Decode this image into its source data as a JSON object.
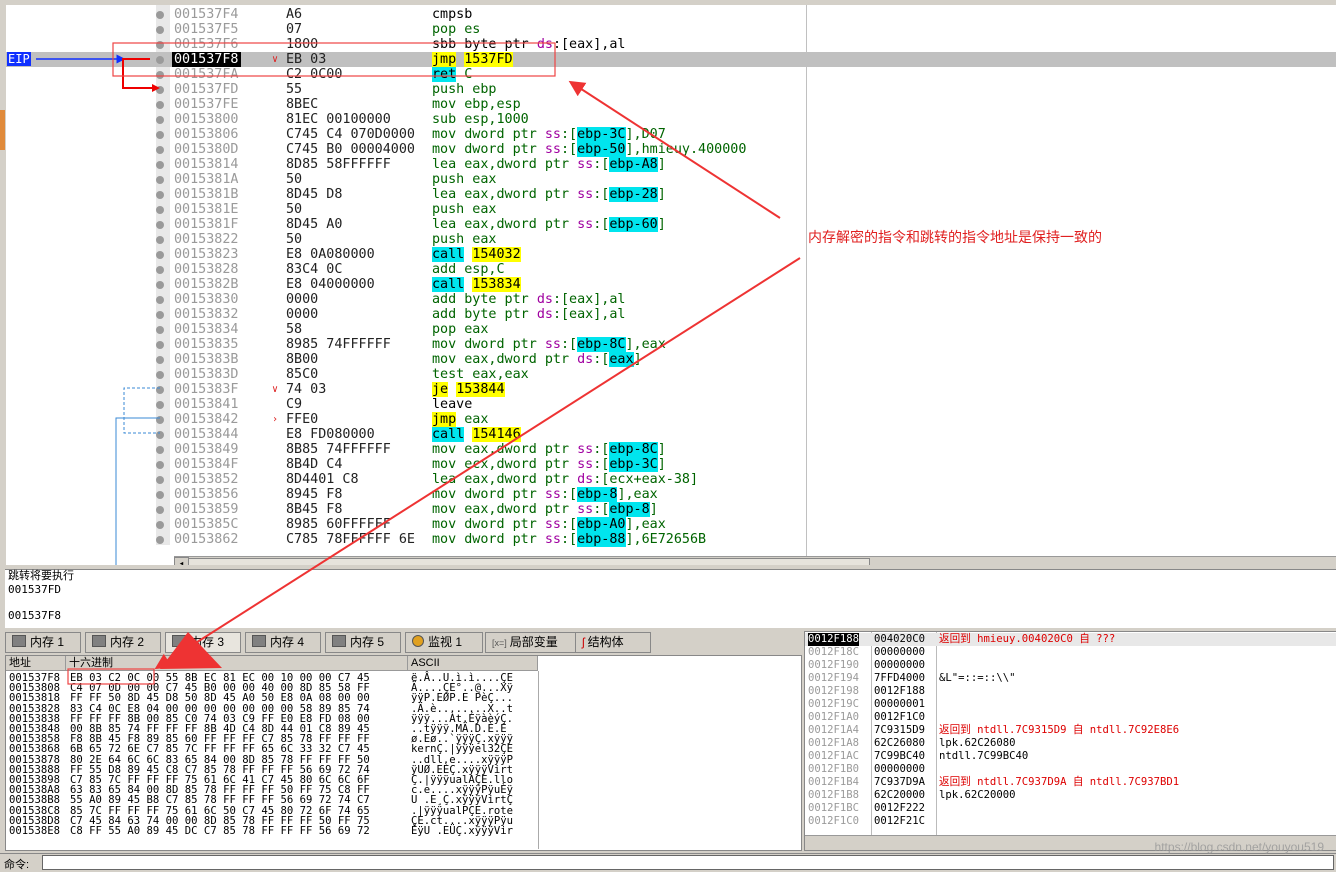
{
  "eip_label": "EIP",
  "disasm": [
    {
      "addr": "001537F4",
      "hex": "A6",
      "asm": [
        [
          "cmpsb",
          "k"
        ]
      ]
    },
    {
      "addr": "001537F5",
      "hex": "07",
      "asm": [
        [
          "pop es",
          "g"
        ]
      ]
    },
    {
      "addr": "001537F6",
      "hex": "1800",
      "asm": [
        [
          "sbb byte ptr ",
          "k"
        ],
        [
          "ds",
          "s"
        ],
        [
          ":[eax],al",
          "k"
        ]
      ]
    },
    {
      "addr": "001537F8",
      "hex": "EB 03",
      "asm": [
        [
          "jmp",
          "y"
        ],
        [
          " ",
          "k"
        ],
        [
          "1537FD",
          "y"
        ]
      ],
      "current": true,
      "arrow": "v"
    },
    {
      "addr": "001537FA",
      "hex": "C2 0C00",
      "asm": [
        [
          "ret",
          "c"
        ],
        [
          " C",
          "g"
        ]
      ]
    },
    {
      "addr": "001537FD",
      "hex": "55",
      "asm": [
        [
          "push ebp",
          "g"
        ]
      ]
    },
    {
      "addr": "001537FE",
      "hex": "8BEC",
      "asm": [
        [
          "mov ebp,esp",
          "g"
        ]
      ]
    },
    {
      "addr": "00153800",
      "hex": "81EC 00100000",
      "asm": [
        [
          "sub esp,1000",
          "g"
        ]
      ]
    },
    {
      "addr": "00153806",
      "hex": "C745 C4 070D0000",
      "asm": [
        [
          "mov dword ptr ",
          "g"
        ],
        [
          "ss",
          "s"
        ],
        [
          ":[",
          "g"
        ],
        [
          "ebp-3C",
          "b"
        ],
        [
          "],D07",
          "g"
        ]
      ]
    },
    {
      "addr": "0015380D",
      "hex": "C745 B0 00004000",
      "asm": [
        [
          "mov dword ptr ",
          "g"
        ],
        [
          "ss",
          "s"
        ],
        [
          ":[",
          "g"
        ],
        [
          "ebp-50",
          "b"
        ],
        [
          "],hmieuy.400000",
          "g"
        ]
      ]
    },
    {
      "addr": "00153814",
      "hex": "8D85 58FFFFFF",
      "asm": [
        [
          "lea eax,dword ptr ",
          "g"
        ],
        [
          "ss",
          "s"
        ],
        [
          ":[",
          "g"
        ],
        [
          "ebp-A8",
          "b"
        ],
        [
          "]",
          "g"
        ]
      ]
    },
    {
      "addr": "0015381A",
      "hex": "50",
      "asm": [
        [
          "push eax",
          "g"
        ]
      ]
    },
    {
      "addr": "0015381B",
      "hex": "8D45 D8",
      "asm": [
        [
          "lea eax,dword ptr ",
          "g"
        ],
        [
          "ss",
          "s"
        ],
        [
          ":[",
          "g"
        ],
        [
          "ebp-28",
          "b"
        ],
        [
          "]",
          "g"
        ]
      ]
    },
    {
      "addr": "0015381E",
      "hex": "50",
      "asm": [
        [
          "push eax",
          "g"
        ]
      ]
    },
    {
      "addr": "0015381F",
      "hex": "8D45 A0",
      "asm": [
        [
          "lea eax,dword ptr ",
          "g"
        ],
        [
          "ss",
          "s"
        ],
        [
          ":[",
          "g"
        ],
        [
          "ebp-60",
          "b"
        ],
        [
          "]",
          "g"
        ]
      ]
    },
    {
      "addr": "00153822",
      "hex": "50",
      "asm": [
        [
          "push eax",
          "g"
        ]
      ]
    },
    {
      "addr": "00153823",
      "hex": "E8 0A080000",
      "asm": [
        [
          "call",
          "c"
        ],
        [
          " ",
          "k"
        ],
        [
          "154032",
          "y"
        ]
      ]
    },
    {
      "addr": "00153828",
      "hex": "83C4 0C",
      "asm": [
        [
          "add esp,C",
          "g"
        ]
      ]
    },
    {
      "addr": "0015382B",
      "hex": "E8 04000000",
      "asm": [
        [
          "call",
          "c"
        ],
        [
          " ",
          "k"
        ],
        [
          "153834",
          "y"
        ]
      ]
    },
    {
      "addr": "00153830",
      "hex": "0000",
      "asm": [
        [
          "add byte ptr ",
          "g"
        ],
        [
          "ds",
          "s"
        ],
        [
          ":[eax],al",
          "g"
        ]
      ]
    },
    {
      "addr": "00153832",
      "hex": "0000",
      "asm": [
        [
          "add byte ptr ",
          "g"
        ],
        [
          "ds",
          "s"
        ],
        [
          ":[eax],al",
          "g"
        ]
      ]
    },
    {
      "addr": "00153834",
      "hex": "58",
      "asm": [
        [
          "pop eax",
          "g"
        ]
      ]
    },
    {
      "addr": "00153835",
      "hex": "8985 74FFFFFF",
      "asm": [
        [
          "mov dword ptr ",
          "g"
        ],
        [
          "ss",
          "s"
        ],
        [
          ":[",
          "g"
        ],
        [
          "ebp-8C",
          "b"
        ],
        [
          "],eax",
          "g"
        ]
      ]
    },
    {
      "addr": "0015383B",
      "hex": "8B00",
      "asm": [
        [
          "mov eax,dword ptr ",
          "g"
        ],
        [
          "ds",
          "s"
        ],
        [
          ":[",
          "g"
        ],
        [
          "eax",
          "b"
        ],
        [
          "]",
          "g"
        ]
      ]
    },
    {
      "addr": "0015383D",
      "hex": "85C0",
      "asm": [
        [
          "test eax,eax",
          "g"
        ]
      ]
    },
    {
      "addr": "0015383F",
      "hex": "74 03",
      "asm": [
        [
          "je",
          "y"
        ],
        [
          " ",
          "k"
        ],
        [
          "153844",
          "y"
        ]
      ],
      "arrow": "v"
    },
    {
      "addr": "00153841",
      "hex": "C9",
      "asm": [
        [
          "leave",
          "k"
        ]
      ]
    },
    {
      "addr": "00153842",
      "hex": "FFE0",
      "asm": [
        [
          "jmp",
          "y"
        ],
        [
          " eax",
          "g"
        ]
      ],
      "arrow": ">"
    },
    {
      "addr": "00153844",
      "hex": "E8 FD080000",
      "asm": [
        [
          "call",
          "c"
        ],
        [
          " ",
          "k"
        ],
        [
          "154146",
          "y"
        ]
      ]
    },
    {
      "addr": "00153849",
      "hex": "8B85 74FFFFFF",
      "asm": [
        [
          "mov eax,dword ptr ",
          "g"
        ],
        [
          "ss",
          "s"
        ],
        [
          ":[",
          "g"
        ],
        [
          "ebp-8C",
          "b"
        ],
        [
          "]",
          "g"
        ]
      ]
    },
    {
      "addr": "0015384F",
      "hex": "8B4D C4",
      "asm": [
        [
          "mov ecx,dword ptr ",
          "g"
        ],
        [
          "ss",
          "s"
        ],
        [
          ":[",
          "g"
        ],
        [
          "ebp-3C",
          "b"
        ],
        [
          "]",
          "g"
        ]
      ]
    },
    {
      "addr": "00153852",
      "hex": "8D4401 C8",
      "asm": [
        [
          "lea eax,dword ptr ",
          "g"
        ],
        [
          "ds",
          "s"
        ],
        [
          ":[ecx+eax-38]",
          "g"
        ]
      ]
    },
    {
      "addr": "00153856",
      "hex": "8945 F8",
      "asm": [
        [
          "mov dword ptr ",
          "g"
        ],
        [
          "ss",
          "s"
        ],
        [
          ":[",
          "g"
        ],
        [
          "ebp-8",
          "b"
        ],
        [
          "],eax",
          "g"
        ]
      ]
    },
    {
      "addr": "00153859",
      "hex": "8B45 F8",
      "asm": [
        [
          "mov eax,dword ptr ",
          "g"
        ],
        [
          "ss",
          "s"
        ],
        [
          ":[",
          "g"
        ],
        [
          "ebp-8",
          "b"
        ],
        [
          "]",
          "g"
        ]
      ]
    },
    {
      "addr": "0015385C",
      "hex": "8985 60FFFFFF",
      "asm": [
        [
          "mov dword ptr ",
          "g"
        ],
        [
          "ss",
          "s"
        ],
        [
          ":[",
          "g"
        ],
        [
          "ebp-A0",
          "b"
        ],
        [
          "],eax",
          "g"
        ]
      ]
    },
    {
      "addr": "00153862",
      "hex": "C785 78FFFFFF 6E",
      "asm": [
        [
          "mov dword ptr ",
          "g"
        ],
        [
          "ss",
          "s"
        ],
        [
          ":[",
          "g"
        ],
        [
          "ebp-88",
          "b"
        ],
        [
          "],6E72656B",
          "g"
        ]
      ]
    }
  ],
  "info": {
    "line1": "跳转将要执行",
    "line2": "001537FD",
    "line3": "",
    "line4": "001537F8"
  },
  "tabs": [
    "内存 1",
    "内存 2",
    "内存 3",
    "内存 4",
    "内存 5",
    "监视 1",
    "局部变量",
    "结构体"
  ],
  "dump": {
    "headers": {
      "addr": "地址",
      "hex": "十六进制",
      "ascii": "ASCII"
    },
    "rows": [
      {
        "a": "001537F8",
        "h": "EB 03 C2 0C 00 55 8B EC 81 EC 00 10 00 00 C7 45",
        "s": "ë.Â..U.ì.ì....ÇE"
      },
      {
        "a": "00153808",
        "h": "C4 07 0D 00 00 C7 45 B0 00 00 40 00 8D 85 58 FF",
        "s": "Ä....ÇE°..@...Xÿ"
      },
      {
        "a": "00153818",
        "h": "FF FF 50 8D 45 D8 50 8D 45 A0 50 E8 0A 08 00 00",
        "s": "ÿÿP.EØP.E PèÇ..."
      },
      {
        "a": "00153828",
        "h": "83 C4 0C E8 04 00 00 00 00 00 00 00 58 89 85 74",
        "s": ".Ä.è........X..t"
      },
      {
        "a": "00153838",
        "h": "FF FF FF 8B 00 85 C0 74 03 C9 FF E0 E8 FD 08 00",
        "s": "ÿÿÿ...Àt.ÉÿàèýÇ."
      },
      {
        "a": "00153848",
        "h": "00 8B 85 74 FF FF FF 8B 4D C4 8D 44 01 C8 89 45",
        "s": "..tÿÿÿ.MÄ.D.È.E"
      },
      {
        "a": "00153858",
        "h": "F8 8B 45 F8 89 85 60 FF FF FF C7 85 78 FF FF FF",
        "s": "ø.Eø..`ÿÿÿÇ.xÿÿÿ"
      },
      {
        "a": "00153868",
        "h": "6B 65 72 6E C7 85 7C FF FF FF 65 6C 33 32 C7 45",
        "s": "kernÇ.|ÿÿÿel32ÇE"
      },
      {
        "a": "00153878",
        "h": "80 2E 64 6C 6C 83 65 84 00 8D 85 78 FF FF FF 50",
        "s": "..dll.e....xÿÿÿP"
      },
      {
        "a": "00153888",
        "h": "FF 55 D8 89 45 C8 C7 85 78 FF FF FF 56 69 72 74",
        "s": "ÿUØ.EÈÇ.xÿÿÿVirt"
      },
      {
        "a": "00153898",
        "h": "C7 85 7C FF FF FF 75 61 6C 41 C7 45 80 6C 6C 6F",
        "s": "Ç.|ÿÿÿualAÇE.llo"
      },
      {
        "a": "001538A8",
        "h": "63 83 65 84 00 8D 85 78 FF FF FF 50 FF 75 C8 FF",
        "s": "c.e....xÿÿÿPÿuÈÿ"
      },
      {
        "a": "001538B8",
        "h": "55 A0 89 45 B8 C7 85 78 FF FF FF 56 69 72 74 C7",
        "s": "U .E¸Ç.xÿÿÿVirtÇ"
      },
      {
        "a": "001538C8",
        "h": "85 7C FF FF FF 75 61 6C 50 C7 45 80 72 6F 74 65",
        "s": ".|ÿÿÿualPÇE.rote"
      },
      {
        "a": "001538D8",
        "h": "C7 45 84 63 74 00 00 8D 85 78 FF FF FF 50 FF 75",
        "s": "ÇE.ct....xÿÿÿPÿu"
      },
      {
        "a": "001538E8",
        "h": "C8 FF 55 A0 89 45 DC C7 85 78 FF FF FF 56 69 72",
        "s": "ÈÿU .EÜÇ.xÿÿÿVir"
      }
    ]
  },
  "stack": [
    {
      "a": "0012F188",
      "v": "004020C0",
      "c": "返回到 hmieuy.004020C0 自 ???",
      "red": true,
      "cur": true
    },
    {
      "a": "0012F18C",
      "v": "00000000",
      "c": ""
    },
    {
      "a": "0012F190",
      "v": "00000000",
      "c": ""
    },
    {
      "a": "0012F194",
      "v": "7FFD4000",
      "c": "&L\"=::=::\\\\\""
    },
    {
      "a": "0012F198",
      "v": "0012F188",
      "c": ""
    },
    {
      "a": "0012F19C",
      "v": "00000001",
      "c": ""
    },
    {
      "a": "0012F1A0",
      "v": "0012F1C0",
      "c": ""
    },
    {
      "a": "0012F1A4",
      "v": "7C9315D9",
      "c": "返回到 ntdll.7C9315D9 自 ntdll.7C92E8E6",
      "red": true
    },
    {
      "a": "0012F1A8",
      "v": "62C26080",
      "c": "lpk.62C26080"
    },
    {
      "a": "0012F1AC",
      "v": "7C99BC40",
      "c": "ntdll.7C99BC40"
    },
    {
      "a": "0012F1B0",
      "v": "00000000",
      "c": ""
    },
    {
      "a": "0012F1B4",
      "v": "7C937D9A",
      "c": "返回到 ntdll.7C937D9A 自 ntdll.7C937BD1",
      "red": true
    },
    {
      "a": "0012F1B8",
      "v": "62C20000",
      "c": "lpk.62C20000"
    },
    {
      "a": "0012F1BC",
      "v": "0012F222",
      "c": ""
    },
    {
      "a": "0012F1C0",
      "v": "0012F21C",
      "c": ""
    }
  ],
  "annotation": "内存解密的指令和跳转的指令地址是保持一致的",
  "command_label": "命令:",
  "watermark": "https://blog.csdn.net/youyou519",
  "colors": {
    "eip": "#1030ff",
    "annotation": "#e02020",
    "call_highlight": "#00e5ee",
    "jump_highlight": "#ffff00"
  }
}
